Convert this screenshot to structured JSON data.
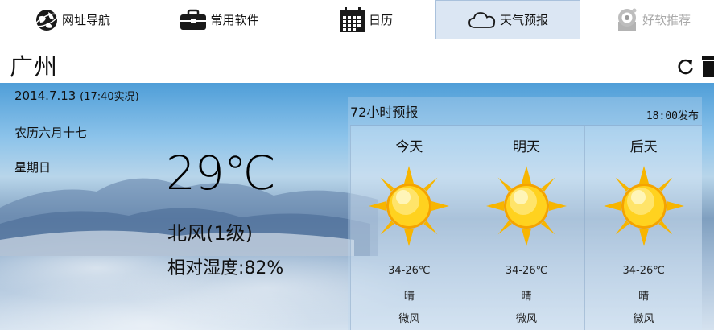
{
  "nav": {
    "items": [
      {
        "label": "网址导航",
        "icon": "globe-icon"
      },
      {
        "label": "常用软件",
        "icon": "briefcase-icon"
      },
      {
        "label": "日历",
        "icon": "calendar-icon"
      },
      {
        "label": "天气预报",
        "icon": "cloud-icon"
      },
      {
        "label": "好软推荐",
        "icon": "safe-icon"
      }
    ],
    "active_index": 3
  },
  "city": "广州",
  "current": {
    "date": "2014.7.13",
    "observed": "(17:40实况)",
    "lunar": "农历六月十七",
    "weekday": "星期日",
    "temperature": "29℃",
    "wind": "北风(1级)",
    "humidity": "相对湿度:82%"
  },
  "forecast": {
    "title": "72小时预报",
    "published": "18:00发布",
    "days": [
      {
        "name": "今天",
        "icon": "sun-icon",
        "range": "34-26℃",
        "condition": "晴",
        "wind": "微风"
      },
      {
        "name": "明天",
        "icon": "sun-icon",
        "range": "34-26℃",
        "condition": "晴",
        "wind": "微风"
      },
      {
        "name": "后天",
        "icon": "sun-icon",
        "range": "34-26℃",
        "condition": "晴",
        "wind": "微风"
      }
    ]
  },
  "colors": {
    "active_tab_bg": "#dbe6f3",
    "active_tab_border": "#a9c1dc",
    "dim_tab_text": "#a8a8a8",
    "sun_yellow": "#ffd21f",
    "sun_orange": "#f5a300"
  }
}
